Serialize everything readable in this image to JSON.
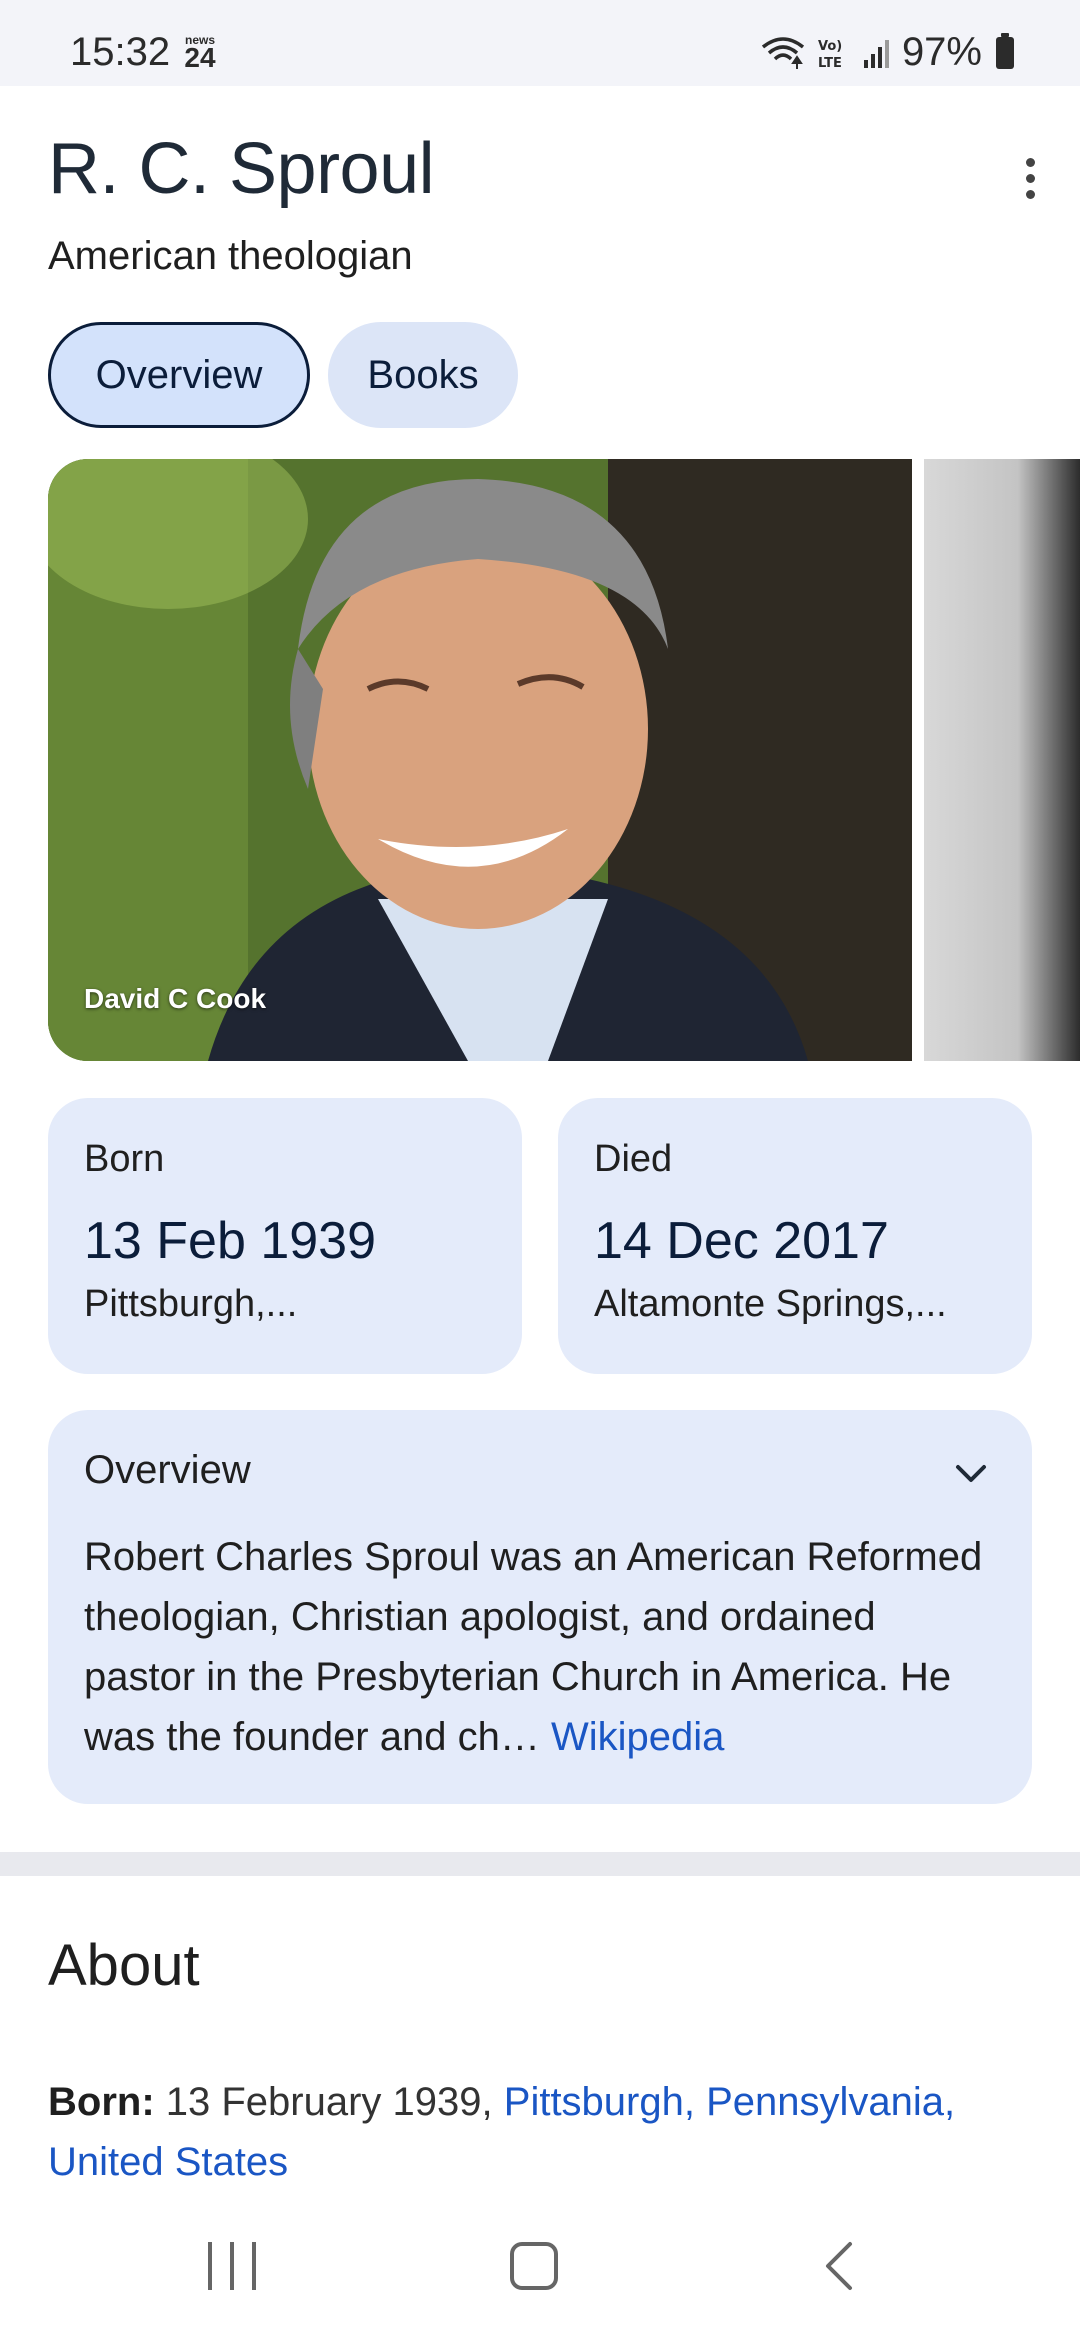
{
  "status_bar": {
    "time": "15:32",
    "news_top": "news",
    "news_num": "24",
    "network": "Vo) LTE",
    "battery": "97%"
  },
  "header": {
    "title": "R. C. Sproul",
    "subtitle": "American theologian"
  },
  "tabs": [
    {
      "label": "Overview",
      "selected": true
    },
    {
      "label": "Books",
      "selected": false
    }
  ],
  "images": {
    "main_credit": "David C Cook"
  },
  "facts": {
    "born": {
      "label": "Born",
      "date": "13 Feb 1939",
      "place": "Pittsburgh,..."
    },
    "died": {
      "label": "Died",
      "date": "14 Dec 2017",
      "place": "Altamonte Springs,..."
    }
  },
  "overview": {
    "title": "Overview",
    "text": "Robert Charles Sproul was an American Reformed theologian, Christian apologist, and ordained pastor in the Presbyterian Church in America. He was the founder and ch…",
    "link": "Wikipedia"
  },
  "about": {
    "heading": "About",
    "born_label": "Born:",
    "born_date": "13 February 1939,",
    "born_place": "Pittsburgh, Pennsylvania, United States"
  },
  "colors": {
    "accent": "#1a56c4",
    "card_bg": "#e4ebfa",
    "chip_selected_bg": "#d3e2fb"
  }
}
